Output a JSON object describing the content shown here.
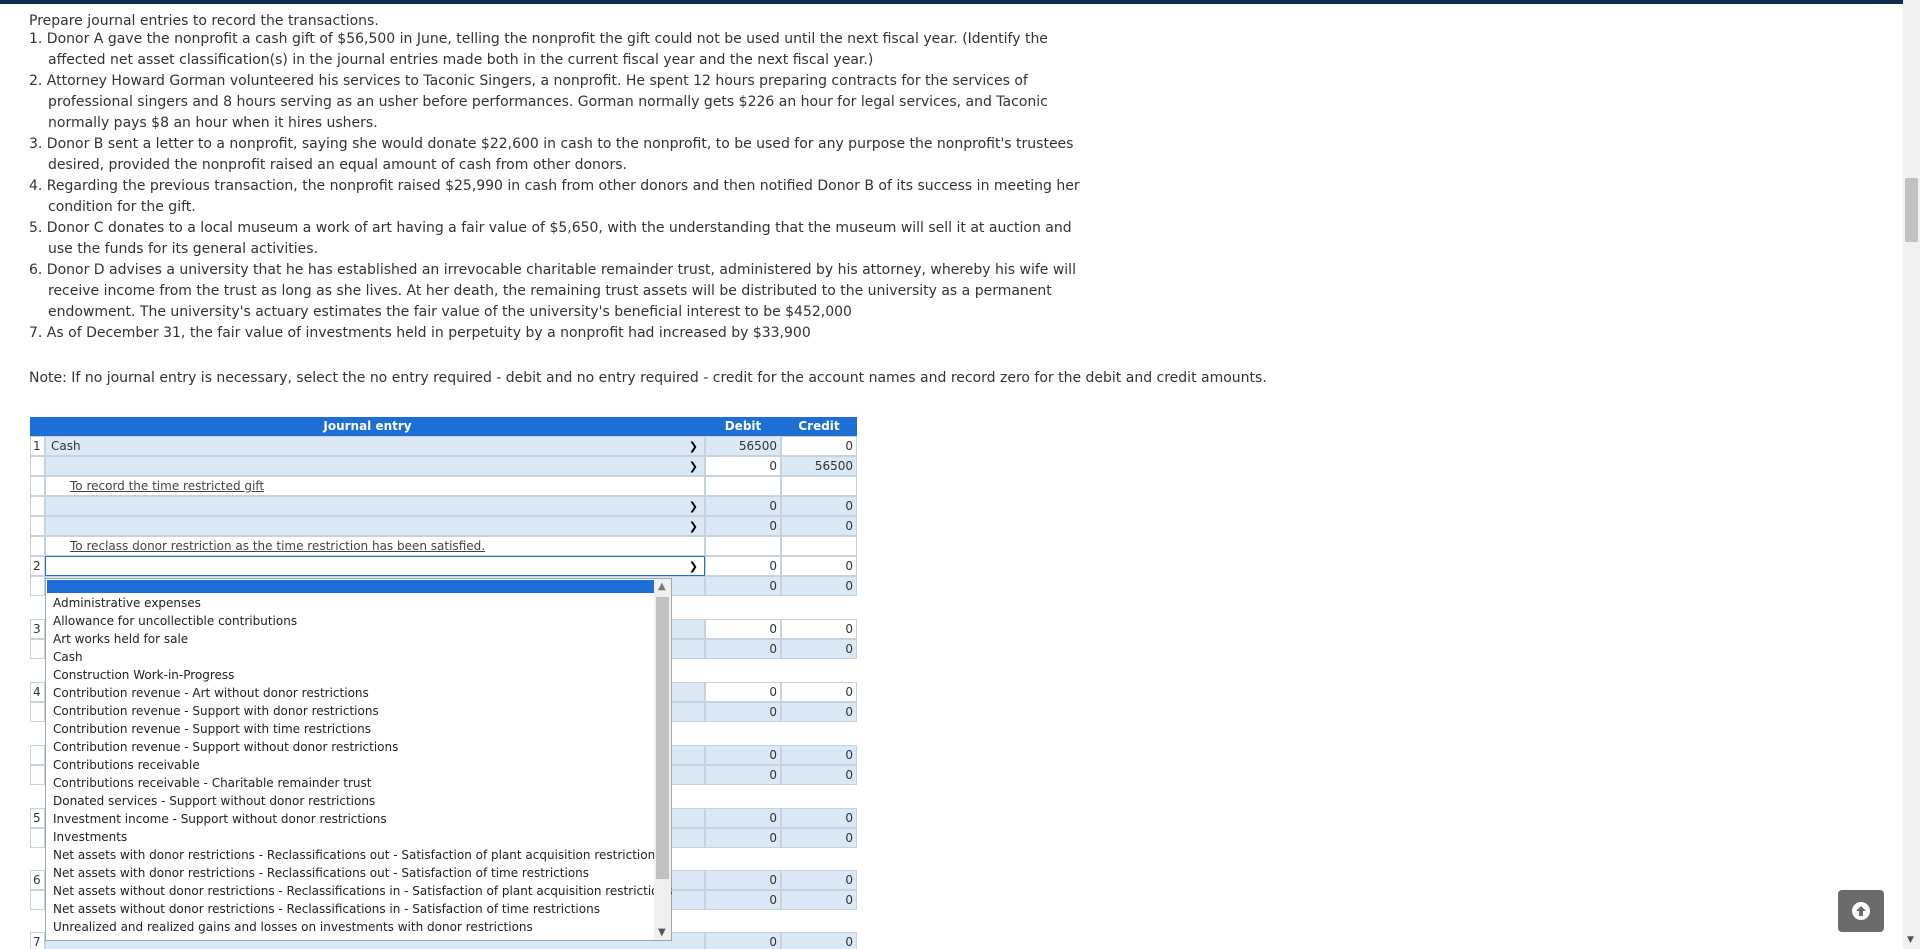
{
  "instructions": {
    "intro": "Prepare journal entries to record the transactions.",
    "items": [
      "1. Donor A gave the nonprofit a cash gift of $56,500 in June, telling the nonprofit the gift could not be used until the next fiscal year. (Identify the affected net asset classification(s) in the journal entries made both in the current fiscal year and the next fiscal year.)",
      "2. Attorney Howard Gorman volunteered his services to Taconic Singers, a nonprofit. He spent 12 hours preparing contracts for the services of professional singers and 8 hours serving as an usher before performances. Gorman normally gets $226 an hour for legal services, and Taconic normally pays $8 an hour when it hires ushers.",
      "3. Donor B sent a letter to a nonprofit, saying she would donate $22,600 in cash to the nonprofit, to be used for any purpose the nonprofit's trustees desired, provided the nonprofit raised an equal amount of cash from other donors.",
      "4. Regarding the previous transaction, the nonprofit raised $25,990 in cash from other donors and then notified Donor B of its success in meeting her condition for the gift.",
      "5. Donor C donates to a local museum a work of art having a fair value of $5,650, with the understanding that the museum will sell it at auction and use the funds for its general activities.",
      "6. Donor D advises a university that he has established an irrevocable charitable remainder trust, administered by his attorney, whereby his wife will receive income from the trust as long as she lives. At her death, the remaining trust assets will be distributed to the university as a permanent endowment. The university's actuary estimates the fair value of the university's beneficial interest to be $452,000",
      "7. As of December 31, the fair value of investments held in perpetuity by a nonprofit had increased by $33,900"
    ],
    "note": "Note: If no journal entry is necessary, select the no entry required - debit and no entry required - credit for the account names and record zero for the debit and credit amounts."
  },
  "journal": {
    "headers": {
      "entry": "Journal entry",
      "debit": "Debit",
      "credit": "Credit"
    },
    "rows": [
      {
        "num": "1",
        "account": "Cash",
        "debit": "56500",
        "credit": "0"
      },
      {
        "num": "",
        "account": "",
        "debit": "0",
        "credit": "56500"
      },
      {
        "memo": "To record the time restricted gift"
      },
      {
        "num": "",
        "account": "",
        "debit": "0",
        "credit": "0"
      },
      {
        "num": "",
        "account": "",
        "debit": "0",
        "credit": "0"
      },
      {
        "memo": "To reclass donor restriction as the time restriction has been satisfied."
      },
      {
        "num": "2",
        "account": "",
        "debit": "0",
        "credit": "0"
      },
      {
        "num": "",
        "account": "",
        "debit": "0",
        "credit": "0"
      }
    ],
    "hidden_rows": [
      {
        "num": "3",
        "debit": "0",
        "credit": "0"
      },
      {
        "num": "",
        "debit": "0",
        "credit": "0"
      },
      {
        "num": "4",
        "debit": "0",
        "credit": "0"
      },
      {
        "num": "",
        "debit": "0",
        "credit": "0"
      },
      {
        "num": "",
        "debit": "0",
        "credit": "0"
      },
      {
        "num": "",
        "debit": "0",
        "credit": "0"
      },
      {
        "num": "5",
        "debit": "0",
        "credit": "0"
      },
      {
        "num": "",
        "debit": "0",
        "credit": "0"
      },
      {
        "num": "6",
        "debit": "0",
        "credit": "0"
      },
      {
        "num": "",
        "debit": "0",
        "credit": "0"
      },
      {
        "num": "7",
        "debit": "0",
        "credit": "0"
      }
    ]
  },
  "dropdown": {
    "options": [
      "Administrative expenses",
      "Allowance for uncollectible contributions",
      "Art works held for sale",
      "Cash",
      "Construction Work-in-Progress",
      "Contribution revenue - Art without donor restrictions",
      "Contribution revenue - Support with donor restrictions",
      "Contribution revenue - Support with time restrictions",
      "Contribution revenue - Support without donor restrictions",
      "Contributions receivable",
      "Contributions receivable - Charitable remainder trust",
      "Donated services - Support without donor restrictions",
      "Investment income - Support without donor restrictions",
      "Investments",
      "Net assets with donor restrictions - Reclassifications out - Satisfaction of plant acquisition restrictions",
      "Net assets with donor restrictions - Reclassifications out - Satisfaction of time restrictions",
      "Net assets without donor restrictions - Reclassifications in - Satisfaction of plant acquisition restrictions",
      "Net assets without donor restrictions - Reclassifications in - Satisfaction of time restrictions",
      "Unrealized and realized gains and losses on investments with donor restrictions"
    ]
  },
  "icons": {
    "chevron": "chevron-down-icon",
    "scroll_top": "arrow-up-icon"
  },
  "colors": {
    "header_blue": "#1d6fd6",
    "row_blue": "#dae9f5",
    "topbar": "#0d2c4d"
  }
}
